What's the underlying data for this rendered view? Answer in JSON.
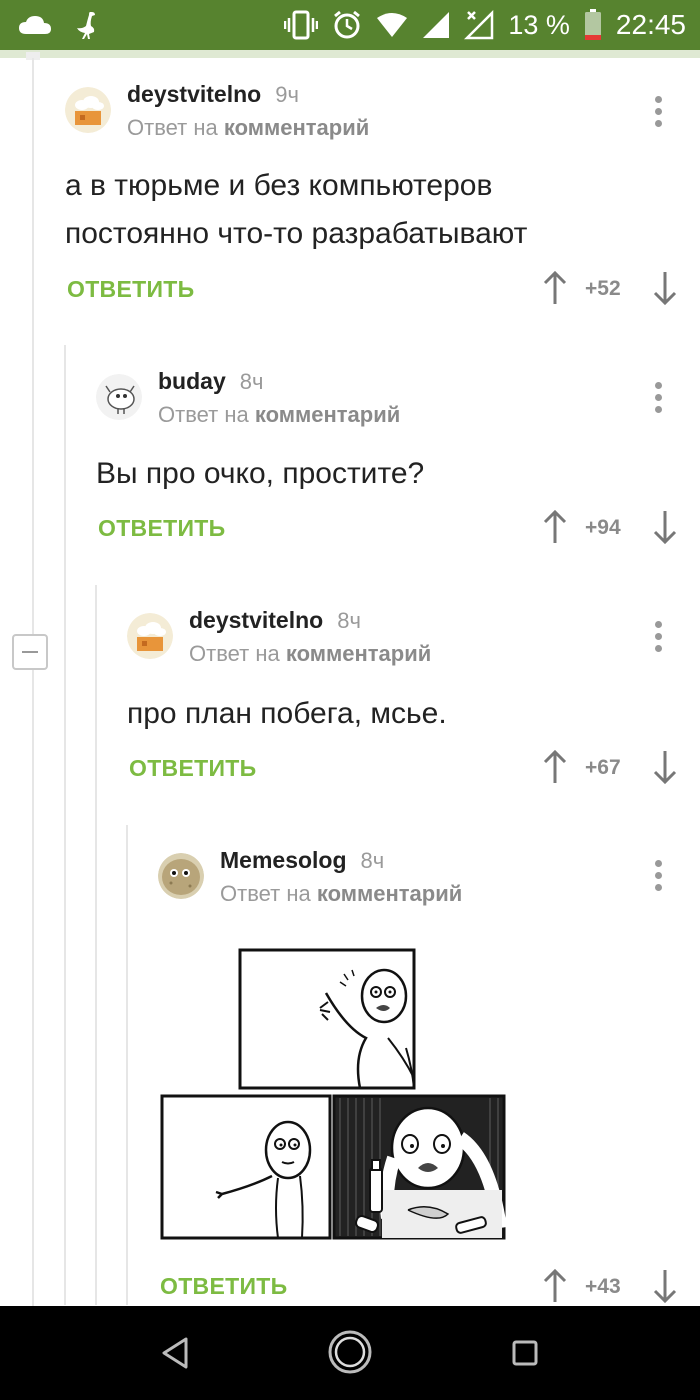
{
  "status_bar": {
    "battery": "13 %",
    "time": "22:45",
    "background": "#57832f",
    "icons": [
      "cloud-icon",
      "ostrich-icon",
      "vibrate-icon",
      "alarm-icon",
      "wifi-icon",
      "signal-icon",
      "no-signal-icon",
      "battery-icon"
    ]
  },
  "comments": [
    {
      "author": "deystvitelno",
      "time": "9ч",
      "reply_prefix": "Ответ на",
      "reply_target": "комментарий",
      "body_lines": [
        "а в тюрьме и без компьютеров",
        "постоянно что-то разрабатывают"
      ],
      "reply_label": "ОТВЕТИТЬ",
      "score": "+52"
    },
    {
      "author": "buday",
      "time": "8ч",
      "reply_prefix": "Ответ на",
      "reply_target": "комментарий",
      "body_lines": [
        "Вы про очко, простите?"
      ],
      "reply_label": "ОТВЕТИТЬ",
      "score": "+94"
    },
    {
      "author": "deystvitelno",
      "time": "8ч",
      "reply_prefix": "Ответ на",
      "reply_target": "комментарий",
      "body_lines": [
        "про план побега, мсье."
      ],
      "reply_label": "ОТВЕТИТЬ",
      "score": "+67"
    },
    {
      "author": "Memesolog",
      "time": "8ч",
      "reply_prefix": "Ответ на",
      "reply_target": "комментарий",
      "image": "rage-comic-meme",
      "reply_label": "ОТВЕТИТЬ",
      "score": "+43"
    }
  ],
  "colors": {
    "accent_green": "#7dbb42",
    "status_green": "#57832f",
    "muted_text": "#9a9a9a"
  },
  "nav_bar": {
    "icons": [
      "back-icon",
      "home-icon",
      "recents-icon"
    ]
  }
}
